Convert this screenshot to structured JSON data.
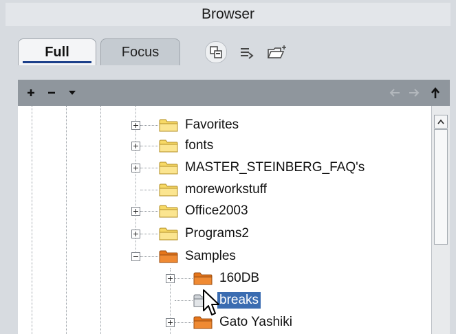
{
  "window": {
    "title": "Browser"
  },
  "tabs": [
    {
      "label": "Full",
      "active": true
    },
    {
      "label": "Focus",
      "active": false
    }
  ],
  "toolbar_icons": [
    "copy-window-icon",
    "redo-arrow-icon",
    "new-folder-icon"
  ],
  "nav_toolbar": {
    "left": [
      "plus-icon",
      "minus-icon",
      "dropdown-arrow-icon"
    ],
    "right": [
      "back-arrow-icon",
      "forward-arrow-icon",
      "up-arrow-icon"
    ]
  },
  "tree": [
    {
      "label": "Favorites",
      "expander": "plus",
      "folder_color": "yellow"
    },
    {
      "label": "fonts",
      "expander": "plus",
      "folder_color": "yellow"
    },
    {
      "label": "MASTER_STEINBERG_FAQ's",
      "expander": "plus",
      "folder_color": "yellow"
    },
    {
      "label": "moreworkstuff",
      "expander": "none",
      "folder_color": "yellow"
    },
    {
      "label": "Office2003",
      "expander": "plus",
      "folder_color": "yellow"
    },
    {
      "label": "Programs2",
      "expander": "plus",
      "folder_color": "yellow"
    },
    {
      "label": "Samples",
      "expander": "minus",
      "folder_color": "orange"
    },
    {
      "label": "160DB",
      "expander": "plus",
      "folder_color": "orange"
    },
    {
      "label": "breaks",
      "expander": "none",
      "folder_color": "grey",
      "selected": true
    },
    {
      "label": "Gato Yashiki",
      "expander": "plus",
      "folder_color": "orange"
    }
  ],
  "colors": {
    "accent": "#1b3f8a",
    "selection": "#3a6cb1",
    "folder_yellow": "#f7d966",
    "folder_orange": "#e6761b",
    "folder_grey": "#cfd3d8"
  }
}
